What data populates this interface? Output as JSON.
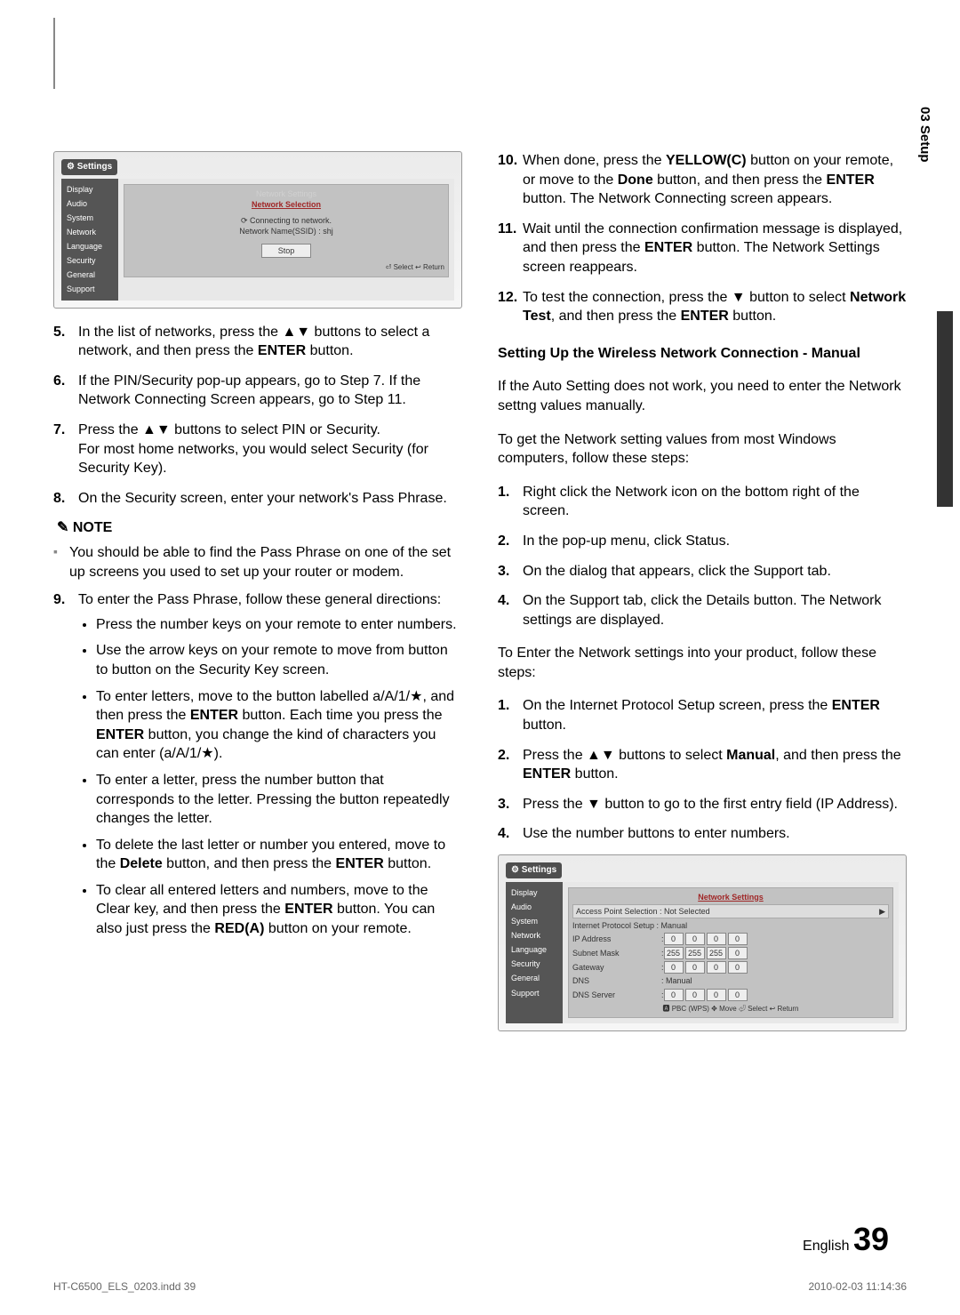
{
  "side_tab": "03  Setup",
  "footer": {
    "lang": "English",
    "page": "39"
  },
  "meta": {
    "file": "HT-C6500_ELS_0203.indd   39",
    "stamp": "2010-02-03    11:14:36"
  },
  "ss1": {
    "title": "Settings",
    "side": [
      "Display",
      "Audio",
      "System",
      "Network",
      "Language",
      "Security",
      "General",
      "Support"
    ],
    "dlg_title": "Network Settings",
    "dlg_sub": "Network Selection",
    "line1": "Connecting to network.",
    "line2": "Network Name(SSID) : shj",
    "stop": "Stop",
    "footer": "⏎ Select    ↩ Return"
  },
  "ss2": {
    "title": "Settings",
    "side": [
      "Display",
      "Audio",
      "System",
      "Network",
      "Language",
      "Security",
      "General",
      "Support"
    ],
    "dlg_title": "Network Settings",
    "row_ap": "Access Point Selection  : Not Selected",
    "row_ips": "Internet Protocol Setup  : Manual",
    "rows": [
      {
        "lbl": "IP Address",
        "vals": [
          "0",
          "0",
          "0",
          "0"
        ]
      },
      {
        "lbl": "Subnet Mask",
        "vals": [
          "255",
          "255",
          "255",
          "0"
        ]
      },
      {
        "lbl": "Gateway",
        "vals": [
          "0",
          "0",
          "0",
          "0"
        ]
      }
    ],
    "dns_lbl": "DNS",
    "dns_val": ": Manual",
    "dns_server": {
      "lbl": "DNS Server",
      "vals": [
        "0",
        "0",
        "0",
        "0"
      ]
    },
    "footer": "🅰 PBC (WPS)   ✥ Move   ⏎ Select   ↩ Return"
  },
  "left": {
    "i5": "In the list of networks, press the ▲▼ buttons to select a network, and then press the <b>ENTER</b> button.",
    "i6": "If the PIN/Security pop-up appears, go to Step 7. If the Network Connecting Screen appears, go to Step 11.",
    "i7": "Press the ▲▼ buttons to select PIN or Security.<br>For most home networks, you would select Security (for Security Key).",
    "i8": "On the Security screen, enter your network's Pass Phrase.",
    "note_head": "✎ NOTE",
    "note": "You should be able to find the Pass Phrase on one of the set up screens you used to set up your router or modem.",
    "i9": "To enter the Pass Phrase, follow these general directions:",
    "b9": [
      "Press the number keys on your remote to enter numbers.",
      "Use the arrow keys on your remote to move from button to button on the Security Key screen.",
      "To enter letters, move to the button labelled a/A/1/★, and then press the <b>ENTER</b> button. Each time you press the <b>ENTER</b> button, you change the kind of characters you can enter (a/A/1/★).",
      "To enter a letter, press the number button that corresponds to the letter. Pressing the button repeatedly changes the letter.",
      "To delete the last letter or number you entered, move to the <b>Delete</b> button, and then press the <b>ENTER</b> button.",
      "To clear all entered letters and numbers, move to the Clear key, and then press the <b>ENTER</b> button. You can also just press the <b>RED(A)</b> button on your remote."
    ]
  },
  "right": {
    "i10": "When done, press the <b>YELLOW(C)</b> button on your remote, or move to the <b>Done</b> button, and then press the <b>ENTER</b> button. The Network Connecting screen appears.",
    "i11": "Wait until the connection confirmation message is displayed, and then press the <b>ENTER</b> button. The Network Settings screen reappears.",
    "i12": "To test the connection, press the ▼ button to select <b>Network Test</b>, and then press the <b>ENTER</b> button.",
    "h4": "Setting Up the Wireless Network Connection - Manual",
    "p1": "If the Auto Setting does not work, you need to enter the Network settng values manually.",
    "p2": "To get the Network setting values from most Windows computers, follow these steps:",
    "s1": [
      "Right click the Network icon on the bottom right of the screen.",
      "In the pop-up menu, click Status.",
      "On the dialog that appears, click the Support tab.",
      "On the Support tab, click the Details button. The Network settings are displayed."
    ],
    "p3": "To Enter the Network settings into your product, follow these steps:",
    "s2": [
      "On the Internet Protocol Setup screen, press the <b>ENTER</b> button.",
      "Press the ▲▼ buttons to select <b>Manual</b>, and then press the <b>ENTER</b> button.",
      "Press the ▼ button to go to the first entry field (IP Address).",
      "Use the number buttons to enter numbers."
    ]
  }
}
